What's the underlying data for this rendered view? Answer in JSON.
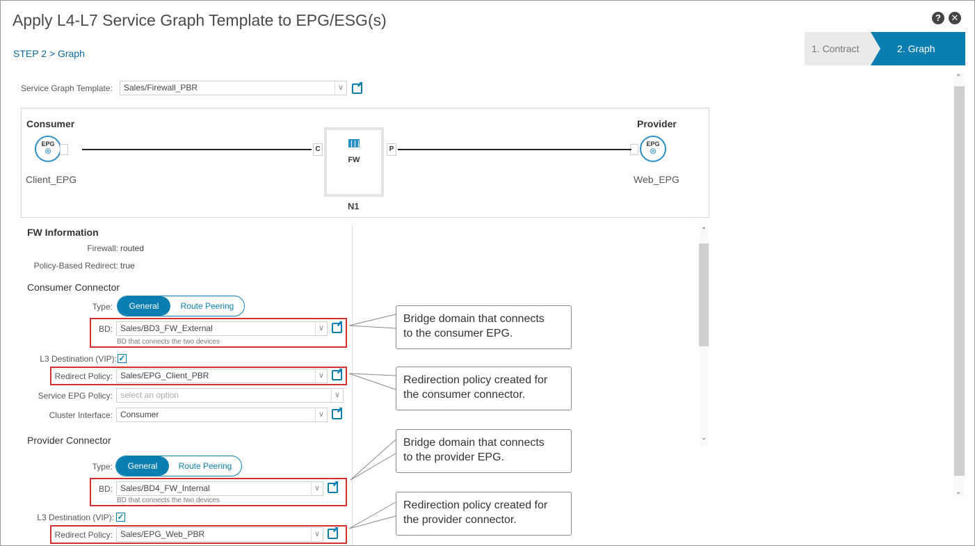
{
  "dialog": {
    "title": "Apply L4-L7 Service Graph Template to EPG/ESG(s)",
    "step_label": "STEP 2 > Graph",
    "help_icon": "?",
    "close_icon": "✕"
  },
  "wizard": {
    "steps": [
      {
        "label": "1. Contract",
        "active": false
      },
      {
        "label": "2. Graph",
        "active": true
      }
    ],
    "accent_color": "#0a7eb0"
  },
  "service_graph_template": {
    "label": "Service Graph Template:",
    "value": "Sales/Firewall_PBR"
  },
  "graph": {
    "consumer": {
      "title": "Consumer",
      "epg_text": "EPG",
      "name": "Client_EPG"
    },
    "provider": {
      "title": "Provider",
      "epg_text": "EPG",
      "name": "Web_EPG"
    },
    "consumer_conn": "C",
    "provider_conn": "P",
    "node": {
      "type": "FW",
      "name": "N1"
    }
  },
  "fw_info": {
    "title": "FW Information",
    "firewall_label": "Firewall:",
    "firewall_value": "routed",
    "pbr_label": "Policy-Based Redirect:",
    "pbr_value": "true"
  },
  "consumer_connector": {
    "title": "Consumer Connector",
    "type_label": "Type:",
    "type_options": [
      "General",
      "Route Peering"
    ],
    "type_selected": "General",
    "bd_label": "BD:",
    "bd_value": "Sales/BD3_FW_External",
    "bd_hint": "BD that connects the two devices",
    "l3_label": "L3 Destination (VIP):",
    "l3_checked": true,
    "redirect_label": "Redirect Policy:",
    "redirect_value": "Sales/EPG_Client_PBR",
    "service_epg_label": "Service EPG Policy:",
    "service_epg_placeholder": "select an option",
    "cluster_label": "Cluster Interface:",
    "cluster_value": "Consumer"
  },
  "provider_connector": {
    "title": "Provider Connector",
    "type_label": "Type:",
    "type_options": [
      "General",
      "Route Peering"
    ],
    "type_selected": "General",
    "bd_label": "BD:",
    "bd_value": "Sales/BD4_FW_Internal",
    "bd_hint": "BD that connects the two devices",
    "l3_label": "L3 Destination (VIP):",
    "l3_checked": true,
    "redirect_label": "Redirect Policy:",
    "redirect_value": "Sales/EPG_Web_PBR"
  },
  "callouts": [
    {
      "line1": "Bridge domain that connects",
      "line2": "to the consumer EPG."
    },
    {
      "line1": "Redirection policy created for",
      "line2": "the consumer connector."
    },
    {
      "line1": "Bridge domain that connects",
      "line2": "to the provider EPG."
    },
    {
      "line1": "Redirection policy created for",
      "line2": "the provider connector."
    }
  ],
  "highlight_color": "#d32f2f"
}
